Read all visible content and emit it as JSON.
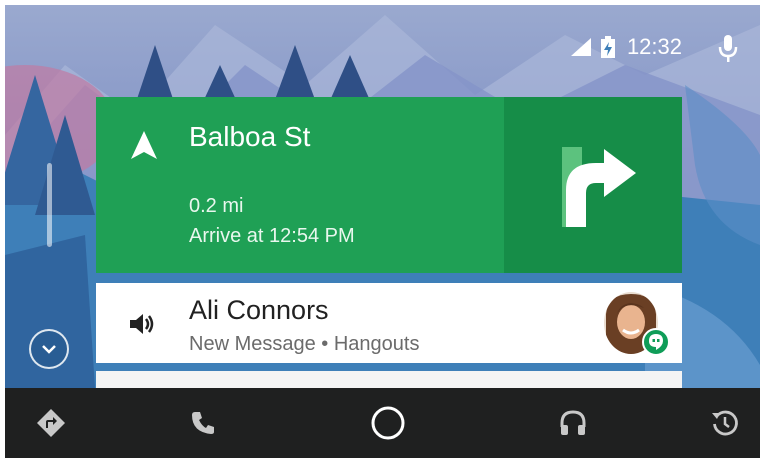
{
  "status_bar": {
    "time": "12:32",
    "icons": [
      "signal-icon",
      "battery-charging-icon",
      "microphone-icon"
    ]
  },
  "navigation_card": {
    "street": "Balboa St",
    "distance": "0.2 mi",
    "arrival": "Arrive at 12:54 PM",
    "maneuver_icon": "turn-right-icon",
    "direction_icon": "navigation-arrow-icon",
    "color": "#1fa055",
    "panel_color": "#168d48"
  },
  "message_card": {
    "contact_name": "Ali Connors",
    "subtitle": "New Message • Hangouts",
    "icon": "speaker-icon",
    "badge_icon": "hangouts-icon",
    "badge_color": "#0f9d58"
  },
  "bottom_nav": {
    "items": [
      "navigation-icon",
      "phone-icon",
      "home-icon",
      "headphones-icon",
      "recents-icon"
    ],
    "background": "#1f2020"
  }
}
